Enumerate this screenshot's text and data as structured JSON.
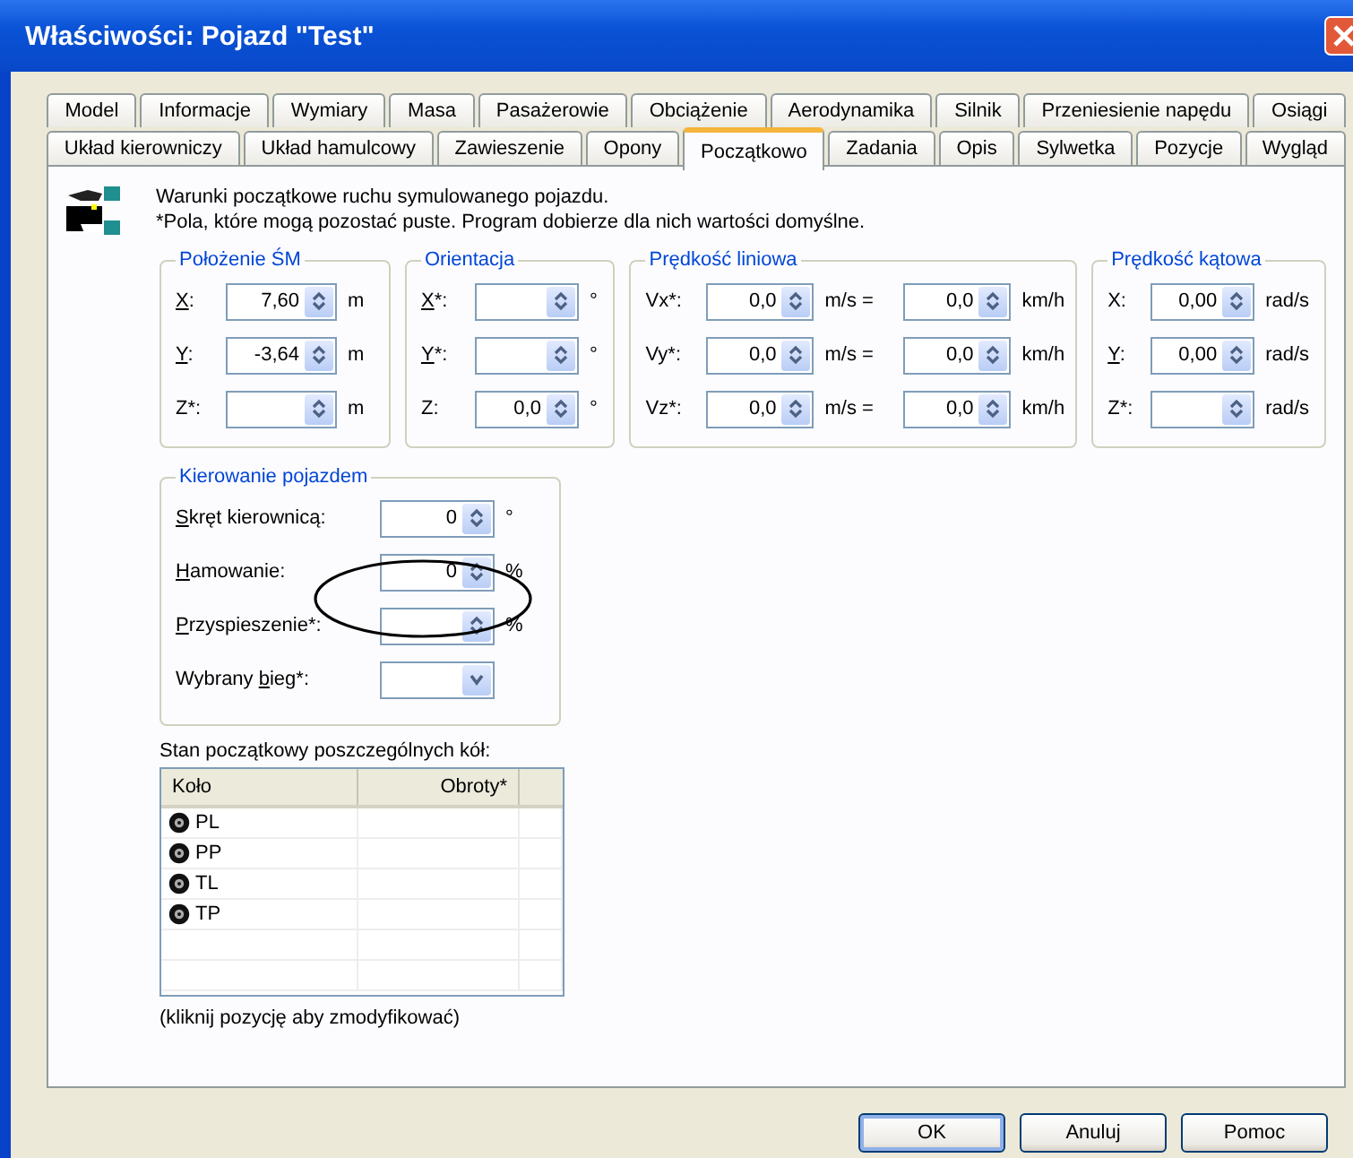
{
  "window": {
    "title": "Właściwości: Pojazd \"Test\""
  },
  "tab_rows": [
    [
      {
        "label": "Model",
        "selected": false
      },
      {
        "label": "Informacje",
        "selected": false
      },
      {
        "label": "Wymiary",
        "selected": false
      },
      {
        "label": "Masa",
        "selected": false
      },
      {
        "label": "Pasażerowie",
        "selected": false
      },
      {
        "label": "Obciążenie",
        "selected": false
      },
      {
        "label": "Aerodynamika",
        "selected": false
      },
      {
        "label": "Silnik",
        "selected": false
      },
      {
        "label": "Przeniesienie napędu",
        "selected": false
      },
      {
        "label": "Osiągi",
        "selected": false
      }
    ],
    [
      {
        "label": "Układ kierowniczy",
        "selected": false
      },
      {
        "label": "Układ hamulcowy",
        "selected": false
      },
      {
        "label": "Zawieszenie",
        "selected": false
      },
      {
        "label": "Opony",
        "selected": false
      },
      {
        "label": "Początkowo",
        "selected": true
      },
      {
        "label": "Zadania",
        "selected": false
      },
      {
        "label": "Opis",
        "selected": false
      },
      {
        "label": "Sylwetka",
        "selected": false
      },
      {
        "label": "Pozycje",
        "selected": false
      },
      {
        "label": "Wygląd",
        "selected": false
      }
    ]
  ],
  "intro": [
    "Warunki początkowe ruchu symulowanego pojazdu.",
    "*Pola, które mogą pozostać puste. Program dobierze dla nich wartości domyślne."
  ],
  "position": {
    "title": "Położenie ŚM",
    "rows": [
      {
        "label": {
          "key": "X",
          "after": ":"
        },
        "value": "7,60",
        "unit": "m"
      },
      {
        "label": {
          "key": "Y",
          "after": ":"
        },
        "value": "-3,64",
        "unit": "m"
      },
      {
        "label": {
          "before": "Z*:"
        },
        "unit": "m"
      }
    ]
  },
  "orientation": {
    "title": "Orientacja",
    "rows": [
      {
        "label": {
          "key": "X",
          "after": "*:"
        },
        "unit": "°"
      },
      {
        "label": {
          "key": "Y",
          "after": "*:"
        },
        "unit": "°"
      },
      {
        "label": {
          "before": "Z:"
        },
        "value": "0,0",
        "unit": "°"
      }
    ]
  },
  "linear_velocity": {
    "title": "Prędkość liniowa",
    "rows": [
      {
        "label": "Vx*:",
        "ms_value": "0,0",
        "ms_unit": "m/s =",
        "kmh_value": "0,0",
        "kmh_unit": "km/h"
      },
      {
        "label": "Vy*:",
        "ms_value": "0,0",
        "ms_unit": "m/s =",
        "kmh_value": "0,0",
        "kmh_unit": "km/h"
      },
      {
        "label": "Vz*:",
        "ms_value": "0,0",
        "ms_unit": "m/s =",
        "kmh_value": "0,0",
        "kmh_unit": "km/h"
      }
    ]
  },
  "angular_velocity": {
    "title": "Prędkość kątowa",
    "rows": [
      {
        "label": {
          "before": "X:"
        },
        "value": "0,00",
        "unit": "rad/s"
      },
      {
        "label": {
          "key": "Y",
          "after": ":"
        },
        "value": "0,00",
        "unit": "rad/s"
      },
      {
        "label": {
          "before": "Z*:"
        },
        "unit": "rad/s"
      }
    ]
  },
  "steering": {
    "title": "Kierowanie pojazdem",
    "rows": [
      {
        "kind": "spinner",
        "label": {
          "key": "S",
          "after": "kręt kierownicą:"
        },
        "value": "0",
        "unit": "°"
      },
      {
        "kind": "spinner",
        "label": {
          "key": "H",
          "after": "amowanie:"
        },
        "value": "0",
        "unit": "%"
      },
      {
        "kind": "spinner",
        "label": {
          "key": "P",
          "after": "rzyspieszenie*:"
        },
        "unit": "%"
      },
      {
        "kind": "dropdown",
        "label": {
          "before": "Wybrany ",
          "key": "b",
          "after": "ieg*:"
        }
      }
    ]
  },
  "wheels": {
    "caption": "Stan początkowy poszczególnych kół:",
    "columns": [
      "Koło",
      "Obroty*"
    ],
    "rows": [
      {
        "name": "PL"
      },
      {
        "name": "PP"
      },
      {
        "name": "TL"
      },
      {
        "name": "TP"
      }
    ],
    "hint": "(kliknij pozycję aby zmodyfikować)"
  },
  "buttons": [
    {
      "label": "OK",
      "default": true
    },
    {
      "label": "Anuluj",
      "default": false
    },
    {
      "label": "Pomoc",
      "default": false
    }
  ]
}
